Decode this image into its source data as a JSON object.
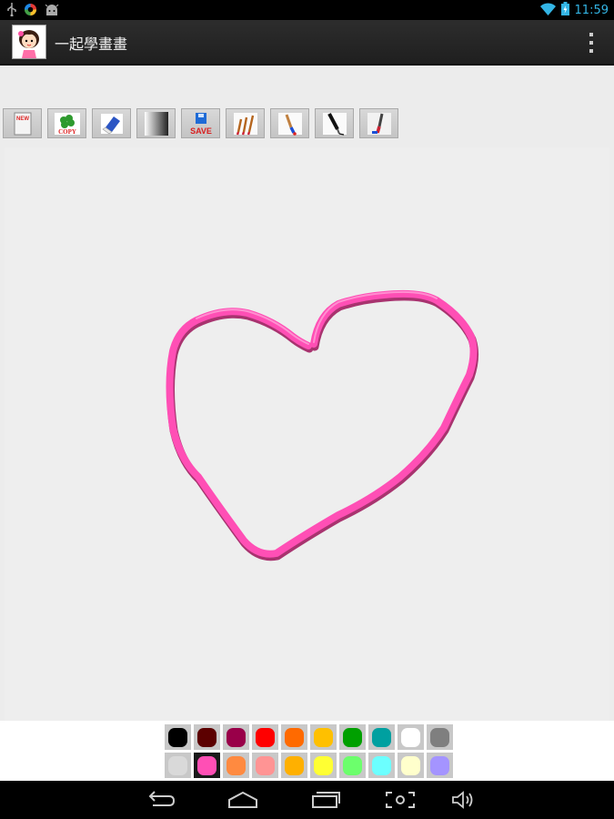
{
  "status_bar": {
    "time": "11:59",
    "left_icons": [
      "usb-icon",
      "color-wheel-icon",
      "android-icon"
    ],
    "right_icons": [
      "wifi-icon",
      "battery-charging-icon"
    ]
  },
  "action_bar": {
    "title": "一起學畫畫",
    "app_icon": "cartoon-girl-icon",
    "menu_icon": "overflow-menu-icon"
  },
  "toolbar": {
    "tools": [
      {
        "name": "new",
        "label": "NEW",
        "icon": "new-page-icon"
      },
      {
        "name": "copy",
        "label": "COPY",
        "icon": "copy-clover-icon"
      },
      {
        "name": "eraser",
        "label": "",
        "icon": "eraser-icon"
      },
      {
        "name": "gradient",
        "label": "",
        "icon": "gradient-icon"
      },
      {
        "name": "save",
        "label": "SAVE",
        "icon": "save-icon"
      },
      {
        "name": "brush-sizes",
        "label": "",
        "icon": "multi-brush-icon"
      },
      {
        "name": "brush",
        "label": "",
        "icon": "brush-icon"
      },
      {
        "name": "pen",
        "label": "",
        "icon": "pen-icon"
      },
      {
        "name": "fill-brush",
        "label": "",
        "icon": "fill-brush-icon"
      }
    ]
  },
  "canvas": {
    "stroke_color": "#ff4fb5",
    "stroke_shadow": "#a8336f",
    "drawing": "heart"
  },
  "palette": {
    "selected_index": 11,
    "colors": [
      "#000000",
      "#5c0000",
      "#990049",
      "#ff0000",
      "#ff6a00",
      "#ffc000",
      "#00a000",
      "#00a0a0",
      "#ffffff",
      "#7f7f7f",
      "#d9d9d9",
      "#ff4fb5",
      "#ff8a40",
      "#ff9494",
      "#ffb000",
      "#ffff33",
      "#6cff6c",
      "#6cffff",
      "#ffffcc",
      "#a494ff"
    ]
  },
  "nav_bar": {
    "buttons": [
      "back-icon",
      "home-icon",
      "recents-icon",
      "screenshot-icon",
      "volume-icon"
    ]
  },
  "colors": {
    "status_accent": "#33b5e5",
    "action_bar_bg": "#262626",
    "canvas_bg": "#eeeeee"
  }
}
